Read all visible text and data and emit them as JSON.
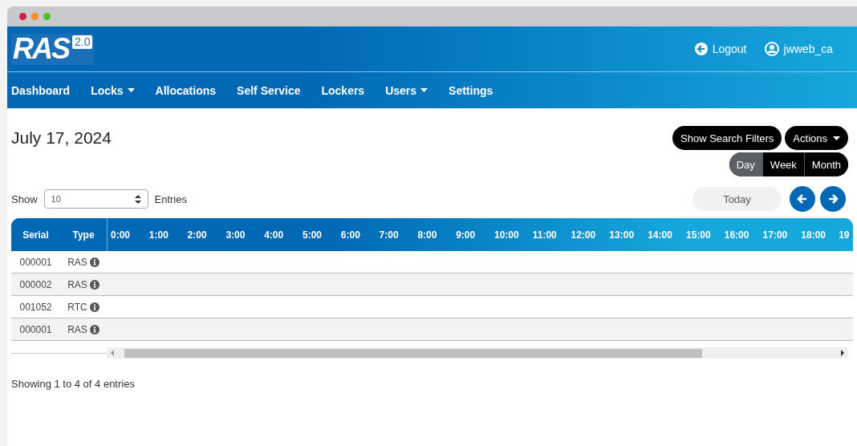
{
  "logo": {
    "name": "RAS",
    "version": "2.0"
  },
  "header_links": [
    {
      "kind": "logout",
      "label": "Logout"
    },
    {
      "kind": "user",
      "label": "jwweb_ca"
    }
  ],
  "nav": [
    {
      "label": "Dashboard",
      "dropdown": false
    },
    {
      "label": "Locks",
      "dropdown": true
    },
    {
      "label": "Allocations",
      "dropdown": false
    },
    {
      "label": "Self Service",
      "dropdown": false
    },
    {
      "label": "Lockers",
      "dropdown": false
    },
    {
      "label": "Users",
      "dropdown": true
    },
    {
      "label": "Settings",
      "dropdown": false
    }
  ],
  "page_title": "July 17, 2024",
  "actions": [
    {
      "label": "Show Search Filters",
      "dropdown": false
    },
    {
      "label": "Actions",
      "dropdown": true
    }
  ],
  "views": [
    {
      "label": "Day",
      "selected": true
    },
    {
      "label": "Week",
      "selected": false
    },
    {
      "label": "Month",
      "selected": false
    }
  ],
  "today_button": "Today",
  "page_size": {
    "prefix": "Show",
    "value": "10",
    "suffix": "Entries"
  },
  "table": {
    "columns": [
      "Serial",
      "Type"
    ],
    "hours": [
      "0:00",
      "1:00",
      "2:00",
      "3:00",
      "4:00",
      "5:00",
      "6:00",
      "7:00",
      "8:00",
      "9:00",
      "10:00",
      "11:00",
      "12:00",
      "13:00",
      "14:00",
      "15:00",
      "16:00",
      "17:00",
      "18:00",
      "19"
    ],
    "rows": [
      {
        "serial": "000001",
        "type": "RAS"
      },
      {
        "serial": "000002",
        "type": "RAS"
      },
      {
        "serial": "001052",
        "type": "RTC"
      },
      {
        "serial": "000001",
        "type": "RAS"
      }
    ]
  },
  "footer": "Showing 1 to 4 of 4 entries"
}
